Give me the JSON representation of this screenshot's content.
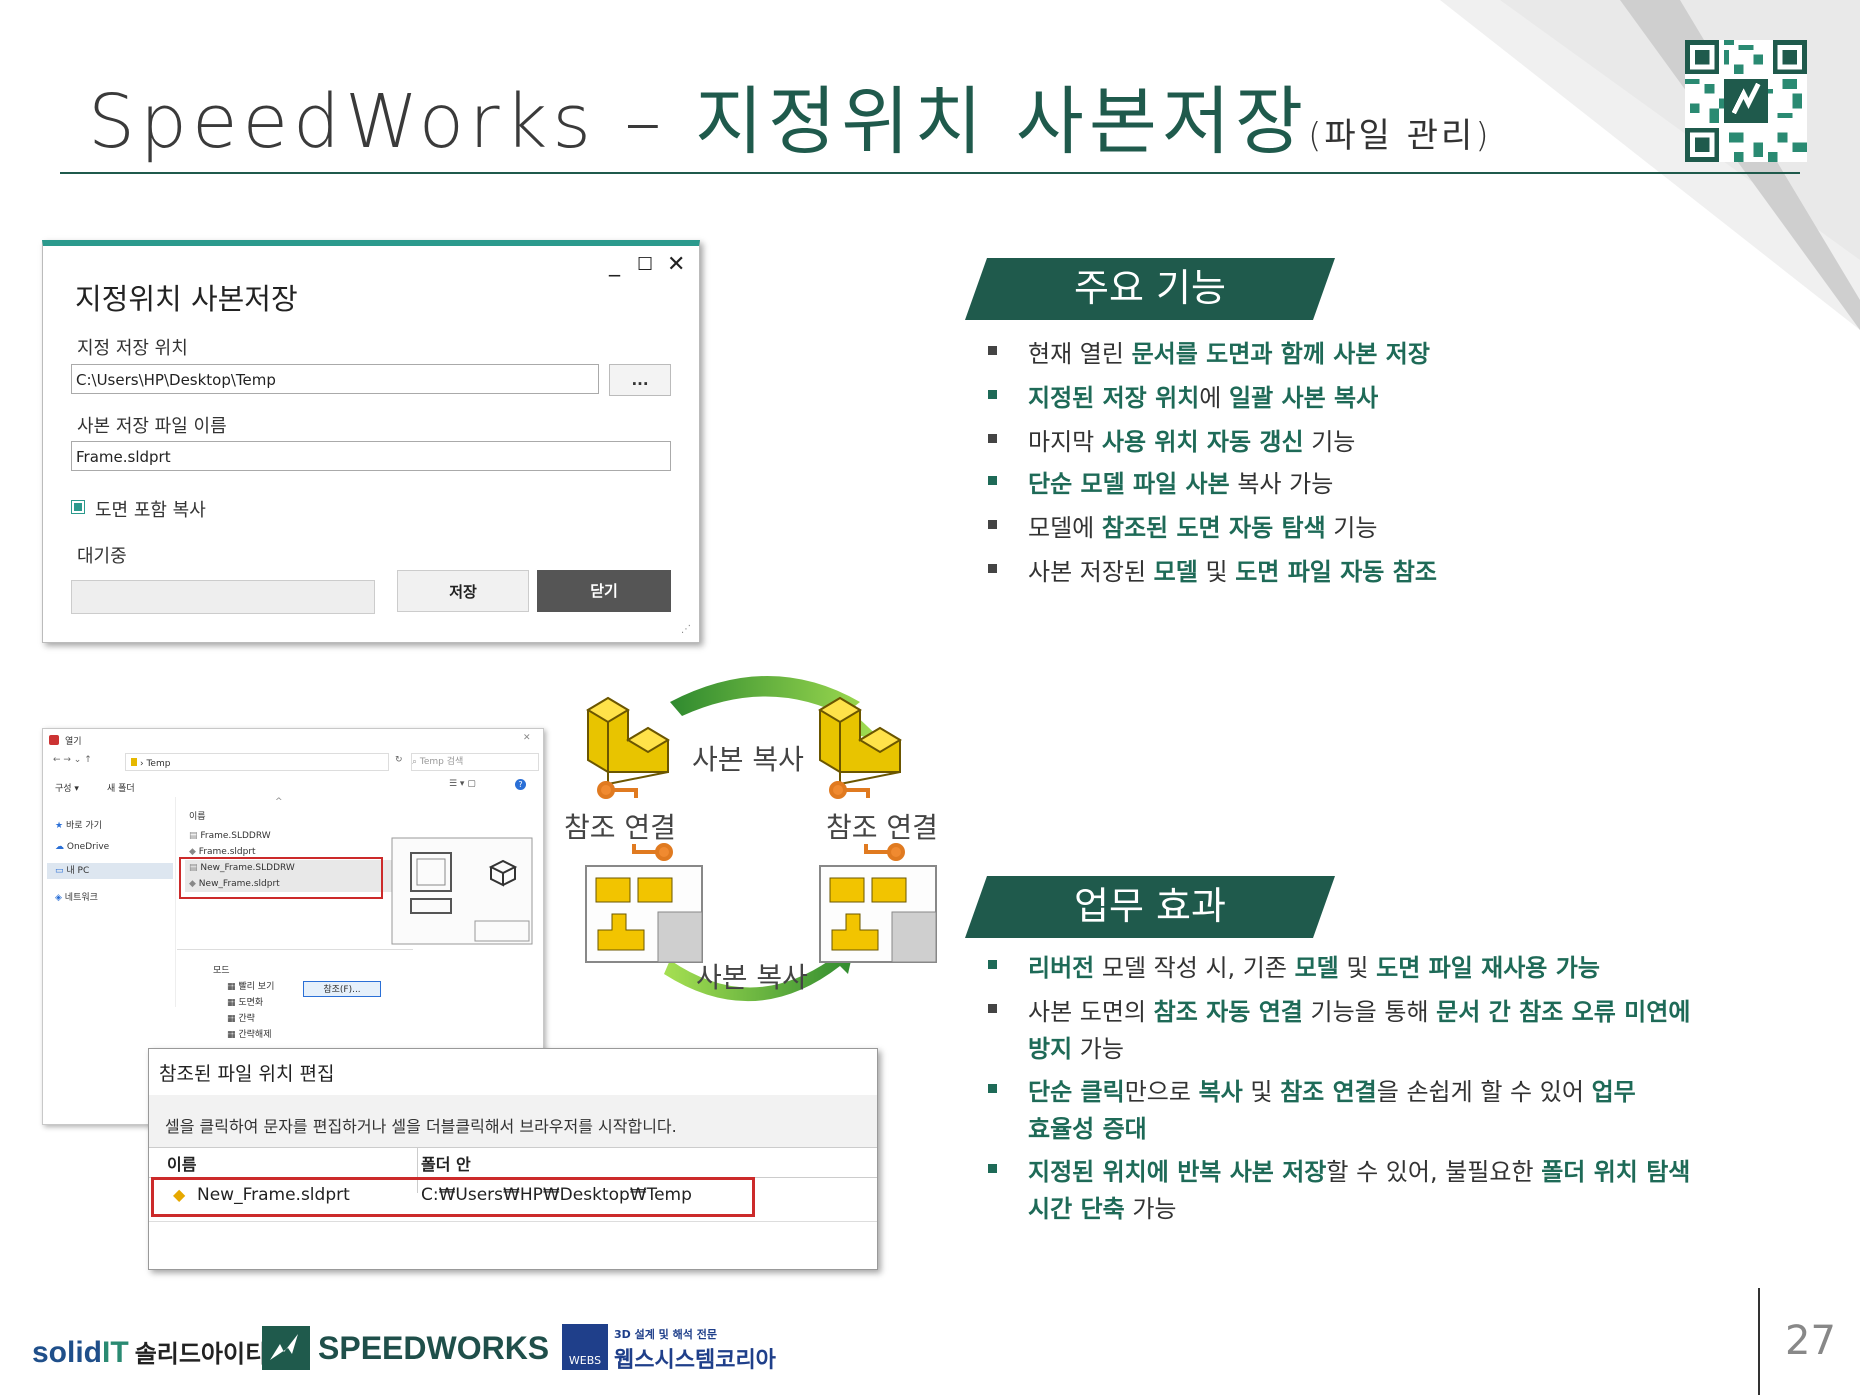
{
  "title": {
    "main": "SpeedWorks – ",
    "highlight": "지정위치 사본저장",
    "sub": "(파일 관리)"
  },
  "dialog": {
    "title": "지정위치 사본저장",
    "controls": {
      "minimize": "_",
      "maximize": "☐",
      "close": "✕"
    },
    "location_label": "지정 저장 위치",
    "location_value": "C:\\Users\\HP\\Desktop\\Temp",
    "browse_label": "...",
    "filename_label": "사본 저장 파일 이름",
    "filename_value": "Frame.sldprt",
    "checkbox_label": "도면 포함 복사",
    "status": "대기중",
    "save_label": "저장",
    "close_label": "닫기"
  },
  "explorer": {
    "title": "열기",
    "path": "Temp",
    "search_placeholder": "Temp 검색",
    "organize": "구성 ▾",
    "new_folder": "새 폴더",
    "nav": [
      "바로 가기",
      "OneDrive",
      "내 PC",
      "네트워크"
    ],
    "col_name": "이름",
    "files": [
      "Frame.SLDDRW",
      "Frame.sldprt",
      "New_Frame.SLDDRW",
      "New_Frame.sldprt"
    ],
    "mode_label": "모드",
    "modes": [
      "빨리 보기",
      "도면화",
      "간략",
      "간략해제"
    ],
    "ref_button": "참조(F)..."
  },
  "ref_dialog": {
    "title": "참조된 파일 위치 편집",
    "hint": "셀을 클릭하여 문자를 편집하거나 셀을 더블클릭해서 브라우저를 시작합니다.",
    "col_name": "이름",
    "col_folder": "폴더 안",
    "row_name": "New_Frame.sldprt",
    "row_folder": "C:₩Users₩HP₩Desktop₩Temp"
  },
  "diagram": {
    "copy_top": "사본 복사",
    "copy_bottom": "사본 복사",
    "link_left": "참조 연결",
    "link_right": "참조 연결"
  },
  "section1": {
    "heading": "주요 기능",
    "items": [
      [
        [
          "현재 열린 ",
          false
        ],
        [
          "문서를 도면과 함께 사본 저장",
          true
        ]
      ],
      [
        [
          "지정된 저장 위치",
          true
        ],
        [
          "에 ",
          false
        ],
        [
          "일괄 사본 복사",
          true
        ]
      ],
      [
        [
          "마지막 ",
          false
        ],
        [
          "사용 위치 자동 갱신",
          true
        ],
        [
          " 기능",
          false
        ]
      ],
      [
        [
          "단순 모델 파일 사본",
          true
        ],
        [
          " 복사 가능",
          false
        ]
      ],
      [
        [
          "모델에 ",
          false
        ],
        [
          "참조된 도면 자동 탐색",
          true
        ],
        [
          " 기능",
          false
        ]
      ],
      [
        [
          "사본 저장된 ",
          false
        ],
        [
          "모델",
          true
        ],
        [
          " 및 ",
          false
        ],
        [
          "도면 파일 자동 참조",
          true
        ]
      ]
    ]
  },
  "section2": {
    "heading": "업무 효과",
    "items": [
      [
        [
          [
            "리버전",
            true
          ],
          [
            " 모델 작성 시, 기존 ",
            false
          ],
          [
            "모델",
            true
          ],
          [
            " 및 ",
            false
          ],
          [
            "도면 파일 재사용 가능",
            true
          ]
        ]
      ],
      [
        [
          [
            "사본 도면의 ",
            false
          ],
          [
            "참조 자동 연결",
            true
          ],
          [
            " 기능을 통해 ",
            false
          ],
          [
            "문서 간 참조 오류 미연에",
            true
          ]
        ],
        [
          [
            "방지",
            true
          ],
          [
            " 가능",
            false
          ]
        ]
      ],
      [
        [
          [
            "단순 클릭",
            true
          ],
          [
            "만으로 ",
            false
          ],
          [
            "복사",
            true
          ],
          [
            " 및 ",
            false
          ],
          [
            "참조 연결",
            true
          ],
          [
            "을 손쉽게 할 수 있어 ",
            false
          ],
          [
            "업무",
            true
          ]
        ],
        [
          [
            "효율성 증대",
            true
          ]
        ]
      ],
      [
        [
          [
            "지정된 위치에 반복 사본 저장",
            true
          ],
          [
            "할 수 있어, 불필요한 ",
            false
          ],
          [
            "폴더 위치 탐색",
            true
          ]
        ],
        [
          [
            "시간 단축",
            true
          ],
          [
            " 가능",
            false
          ]
        ]
      ]
    ]
  },
  "footer": {
    "logo1_a": "solid",
    "logo1_b": "IT",
    "logo1_c": "솔리드아이티",
    "logo2": "SPEEDWORKS",
    "logo3_small": "3D 설계 및 해석 전문",
    "logo3_mark": "WEBS",
    "logo3_name": "웹스시스템코리아",
    "page": "27"
  },
  "colors": {
    "accent": "#1e6a57",
    "header": "#1f5a4c",
    "dialog_top": "#2b9a8d",
    "red_box": "#cc2a2a"
  }
}
